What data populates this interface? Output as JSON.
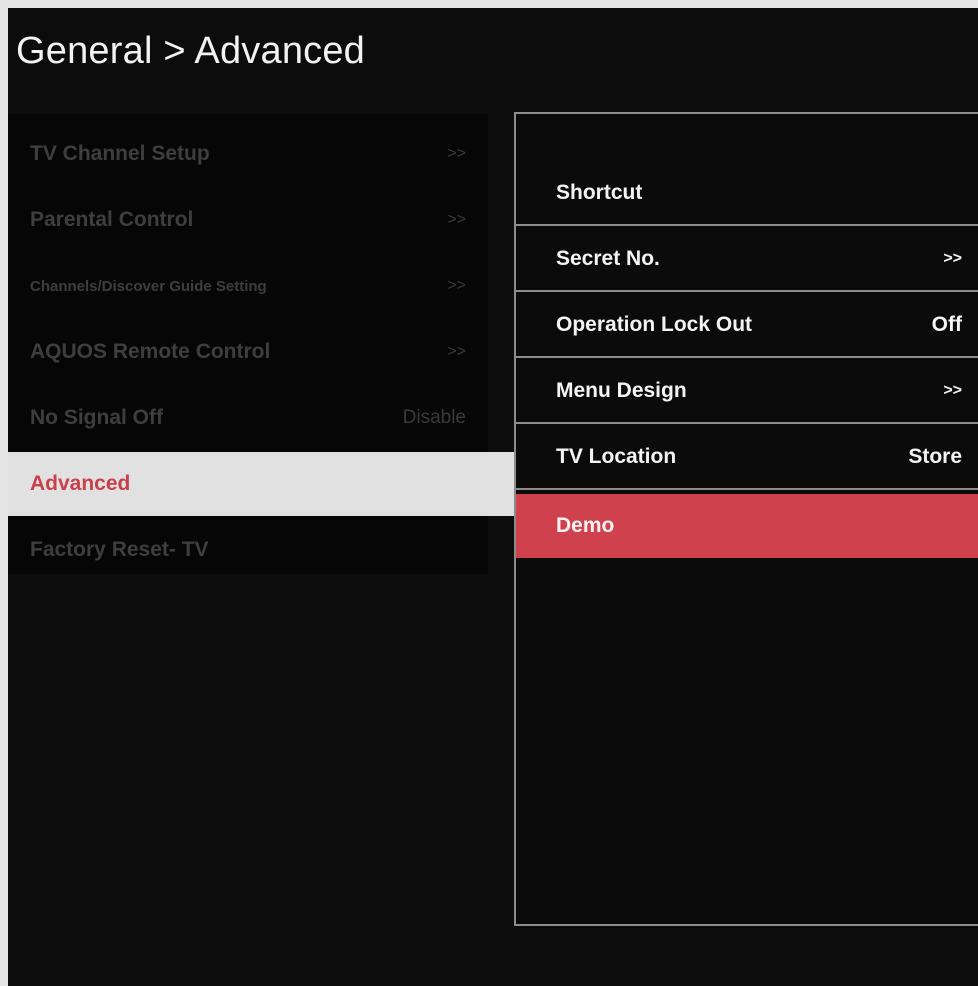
{
  "header": {
    "title": "General > Advanced"
  },
  "left_menu": {
    "items": [
      {
        "label": "TV Channel Setup",
        "arrow": ">>"
      },
      {
        "label": "Parental Control",
        "arrow": ">>"
      },
      {
        "label": "Channels/Discover Guide Setting",
        "arrow": ">>"
      },
      {
        "label": "AQUOS Remote Control",
        "arrow": ">>"
      },
      {
        "label": "No Signal Off",
        "value": "Disable"
      },
      {
        "label": "Advanced"
      },
      {
        "label": "Factory Reset- TV"
      }
    ],
    "selected_index": 5
  },
  "submenu": {
    "items": [
      {
        "label": "Shortcut"
      },
      {
        "label": "Secret No.",
        "arrow": ">>"
      },
      {
        "label": "Operation Lock Out",
        "value": "Off"
      },
      {
        "label": "Menu Design",
        "arrow": ">>"
      },
      {
        "label": "TV Location",
        "value": "Store"
      },
      {
        "label": "Demo"
      }
    ],
    "selected_index": 5
  },
  "colors": {
    "accent": "#cf414c",
    "background": "#0c0c0c",
    "selected_row": "#e1e1e1"
  }
}
